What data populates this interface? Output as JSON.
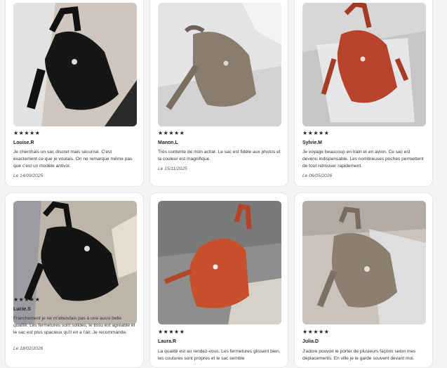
{
  "reviews": [
    {
      "stars": "★★★★★",
      "author": "Louise.R",
      "text": "Je cherchais un sac discret mais sécurisé. C'est exactement ce que je voulais. On ne remarque même pas que c'est un modèle antivol.",
      "date": "Le 14/09/2025",
      "bag_color": "#161616",
      "photo_bg": "#cfc6bd"
    },
    {
      "stars": "★★★★★",
      "author": "Manon.L",
      "text": "Très contente de mon achat. Le sac est fidèle aux photos et la couleur est magnifique.",
      "date": "Le 15/11/2025",
      "bag_color": "#8a7d6e",
      "photo_bg": "#e4e4e6"
    },
    {
      "stars": "★★★★★",
      "author": "Sylvie.M",
      "text": "Je voyage beaucoup en train et en avion. Ce sac est devenu indispensable. Les nombreuses poches permettent de tout retrouver rapidement.",
      "date": "Le 06/05/2026",
      "bag_color": "#b8432a",
      "photo_bg": "#d8d6d6"
    },
    {
      "stars": "★★★★★",
      "author": "Lucie.S",
      "text": "Franchement je ne m'attendais pas à une aussi belle qualité. Les fermetures sont solides, le tissu est agréable et le sac est plus spacieux qu'il en a l'air. Je recommande.",
      "date": "Le 18/02/2026",
      "bag_color": "#141414",
      "photo_bg": "#bdb5aa"
    },
    {
      "stars": "★★★★★",
      "author": "Laura.R",
      "text": "La qualité est au rendez-vous. Les fermetures glissent bien, les coutures sont propres et le sac semble",
      "date": "",
      "bag_color": "#c9502c",
      "photo_bg": "#8e8e8c"
    },
    {
      "stars": "★★★★★",
      "author": "Julia.D",
      "text": "J'adore pouvoir le porter de plusieurs façons selon mes déplacements. En ville je le garde souvent devant moi.",
      "date": "",
      "bag_color": "#8c7f70",
      "photo_bg": "#c9c3bb"
    }
  ]
}
